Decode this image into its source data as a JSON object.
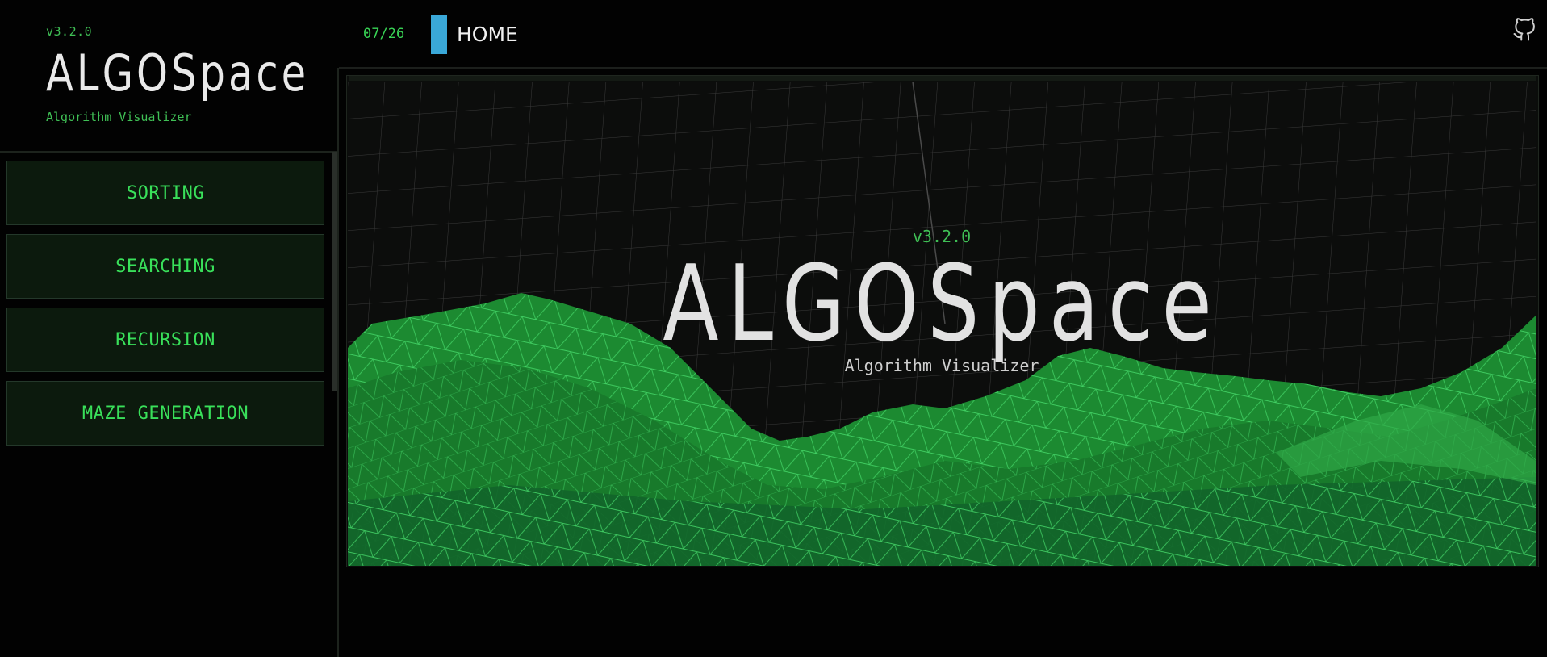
{
  "sidebar": {
    "version": "v3.2.0",
    "title": "ALGOSpace",
    "subtitle": "Algorithm Visualizer",
    "nav": [
      {
        "label": "SORTING"
      },
      {
        "label": "SEARCHING"
      },
      {
        "label": "RECURSION"
      },
      {
        "label": "MAZE GENERATION"
      }
    ]
  },
  "topbar": {
    "counter": "07/26",
    "tab_label": "HOME",
    "github_icon": "github-icon"
  },
  "hero": {
    "version": "v3.2.0",
    "title": "ALGOSpace",
    "subtitle": "Algorithm Visualizer"
  },
  "colors": {
    "accent_green": "#39e05a",
    "tab_marker": "#3aa8d8",
    "background": "#020202"
  }
}
